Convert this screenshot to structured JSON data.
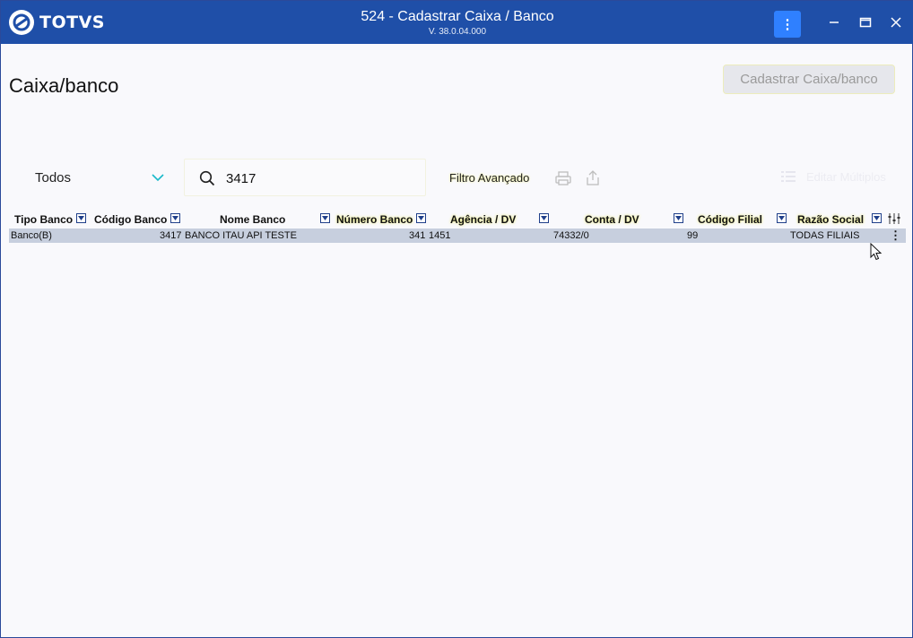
{
  "titlebar": {
    "logo_text": "TOTVS",
    "title": "524 - Cadastrar Caixa / Banco",
    "version": "V. 38.0.04.000",
    "menu_label": "⋮"
  },
  "page": {
    "title": "Caixa/banco",
    "primary_button": "Cadastrar Caixa/banco"
  },
  "toolbar": {
    "filter_select_value": "Todos",
    "search_value": "3417",
    "advanced_filter_label": "Filtro Avançado",
    "multi_select_label": "Editar Múltiplos"
  },
  "table": {
    "columns": [
      "Tipo Banco",
      "Código Banco",
      "Nome Banco",
      "Número Banco",
      "Agência / DV",
      "Conta / DV",
      "Código Filial",
      "Razão Social"
    ],
    "rows": [
      {
        "tipo_banco": "Banco(B)",
        "codigo_banco": "3417",
        "nome_banco": "BANCO ITAU API TESTE",
        "numero_banco": "341",
        "agencia_dv": "1451",
        "conta_dv": "74332/0",
        "codigo_filial": "99",
        "razao_social": "TODAS FILIAIS"
      }
    ]
  },
  "colors": {
    "titlebar": "#1f4fa8",
    "accent_button": "#2f80ff",
    "row_selected": "#c7cfde",
    "background": "#f9f9fc"
  },
  "icons": {
    "menu": "kebab-icon",
    "minimize": "minimize-icon",
    "maximize": "maximize-icon",
    "close": "close-icon",
    "search": "search-icon",
    "print": "print-icon",
    "export": "export-icon",
    "list": "list-icon",
    "column_filter": "filter-icon",
    "column_settings": "column-settings-icon",
    "row_menu": "kebab-icon",
    "cursor": "mouse-cursor-icon"
  }
}
